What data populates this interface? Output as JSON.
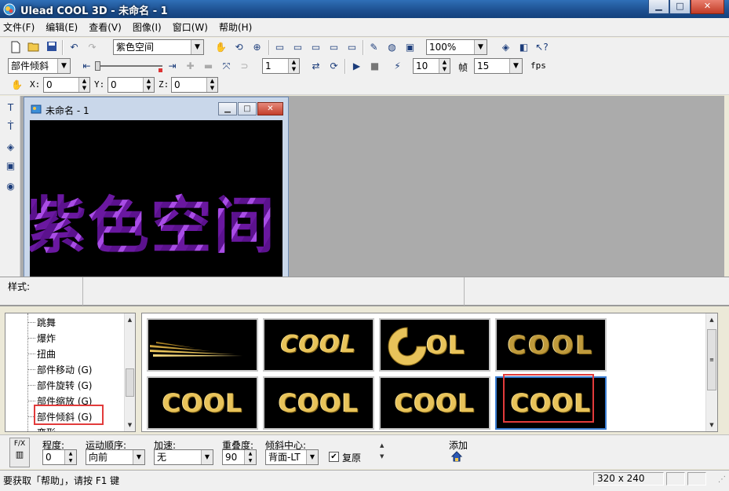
{
  "window": {
    "title": "Ulead COOL 3D - 未命名 - 1",
    "minimize": "▁",
    "maximize": "□",
    "close": "✕"
  },
  "menu": [
    "文件(F)",
    "编辑(E)",
    "查看(V)",
    "图像(I)",
    "窗口(W)",
    "帮助(H)"
  ],
  "toolbar1": {
    "text_combo": "紫色空间",
    "zoom_combo": "100%"
  },
  "toolbar2": {
    "effect_combo": "部件倾斜",
    "frame_value": "1",
    "frames_value": "10",
    "frames_label": "帧",
    "fps_value": "15",
    "fps_label": "fps"
  },
  "toolbar3": {
    "x_label": "X:",
    "x_value": "0",
    "y_label": "Y:",
    "y_value": "0",
    "z_label": "Z:",
    "z_value": "0"
  },
  "document": {
    "title": "未命名 - 1",
    "canvas_text": "紫色空间"
  },
  "style_bar": {
    "label": "样式:"
  },
  "tree": {
    "items": [
      "跳舞",
      "爆炸",
      "扭曲",
      "部件移动 (G)",
      "部件旋转 (G)",
      "部件缩放 (G)",
      "部件倾斜 (G)",
      "变形"
    ],
    "selected_index": 6
  },
  "gallery": {
    "thumbnails": [
      {
        "label": ""
      },
      {
        "label": "COOL"
      },
      {
        "label": "OL"
      },
      {
        "label": "COOL"
      },
      {
        "label": "COOL"
      },
      {
        "label": "COOL"
      },
      {
        "label": "COOL"
      },
      {
        "label": "COOL"
      }
    ],
    "selected_index": 7
  },
  "properties": {
    "fx_label": "F/X",
    "degree_label": "程度:",
    "degree_value": "0",
    "order_label": "运动顺序:",
    "order_value": "向前",
    "accel_label": "加速:",
    "accel_value": "无",
    "overlap_label": "重叠度:",
    "overlap_value": "90",
    "center_label": "倾斜中心:",
    "center_value": "背面-LT",
    "reset_label": "复原",
    "reset_checked": "✔",
    "add_label": "添加"
  },
  "status": {
    "help_text": "要获取「帮助」，请按 F1 键",
    "size": "320 x 240"
  }
}
